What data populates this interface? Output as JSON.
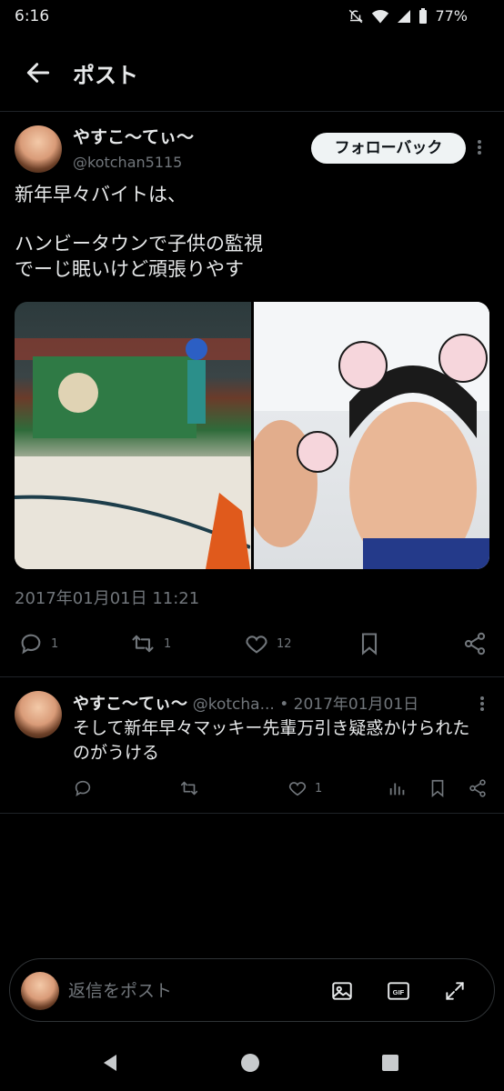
{
  "status_bar": {
    "time": "6:16",
    "battery": "77%"
  },
  "header": {
    "title": "ポスト"
  },
  "post": {
    "author_name": "やすこ〜てぃ〜",
    "author_handle": "@kotchan5115",
    "follow_label": "フォローバック",
    "text_line1": "新年早々バイトは、",
    "text_line2": "ハンビータウンで子供の監視",
    "text_line3": "でーじ眠いけど頑張りやす",
    "timestamp": "2017年01月01日 11:21",
    "stats": {
      "replies": "1",
      "reposts": "1",
      "likes": "12"
    }
  },
  "reply": {
    "author_name": "やすこ〜てぃ〜",
    "meta": "@kotcha... • 2017年01月01日",
    "text": "そして新年早々マッキー先輩万引き疑惑かけられたのがうける",
    "stats": {
      "replies": "",
      "reposts": "",
      "likes": "1"
    }
  },
  "compose": {
    "placeholder": "返信をポスト",
    "gif_label": "GIF"
  },
  "icons": {
    "back": "arrow-left-icon",
    "reply": "reply-icon",
    "repost": "repost-icon",
    "like": "heart-icon",
    "bookmark": "bookmark-icon",
    "share": "share-icon",
    "views": "views-chart-icon",
    "image": "image-icon",
    "gif": "gif-icon",
    "expand": "expand-icon"
  },
  "colors": {
    "background": "#000000",
    "text": "#e7e9ea",
    "muted": "#71767b",
    "follow_bg": "#eff3f4"
  }
}
